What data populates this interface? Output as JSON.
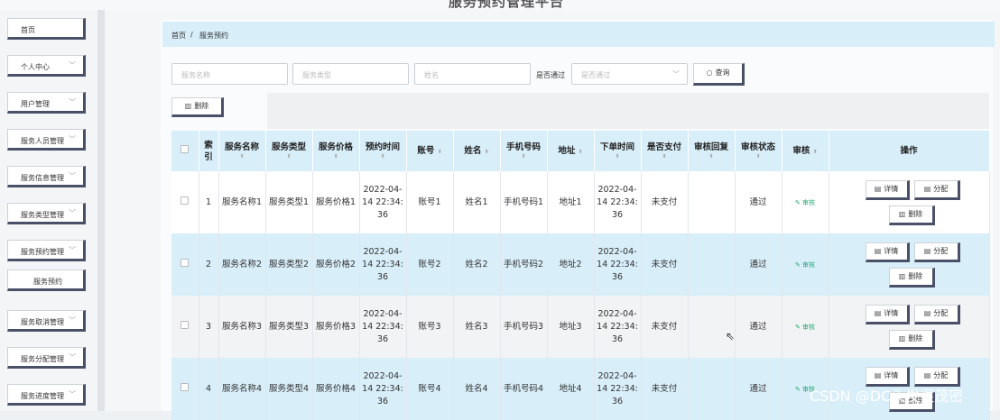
{
  "page": {
    "title": "服务预约管理平台"
  },
  "sidebar": {
    "items": [
      {
        "label": "首页",
        "expandable": false
      },
      {
        "label": "个人中心",
        "expandable": true
      },
      {
        "label": "用户管理",
        "expandable": true
      },
      {
        "label": "服务人员管理",
        "expandable": true
      },
      {
        "label": "服务信息管理",
        "expandable": true
      },
      {
        "label": "服务类型管理",
        "expandable": true
      },
      {
        "label": "服务预约管理",
        "expandable": true
      },
      {
        "label": "服务预约",
        "expandable": false
      },
      {
        "label": "服务取消管理",
        "expandable": true
      },
      {
        "label": "服务分配管理",
        "expandable": true
      },
      {
        "label": "服务进度管理",
        "expandable": true
      }
    ]
  },
  "breadcrumb": {
    "home": "首页",
    "separator": "/",
    "current": "服务预约"
  },
  "filters": {
    "service_name_placeholder": "服务名称",
    "service_type_placeholder": "服务类型",
    "name_placeholder": "姓名",
    "approved_label": "是否通过",
    "approved_placeholder": "是否通过",
    "search_label": "查询",
    "delete_label": "删除"
  },
  "table": {
    "headers": {
      "index": "索引",
      "service_name": "服务名称",
      "service_type": "服务类型",
      "service_price": "服务价格",
      "booking_time": "预约时间",
      "account": "账号",
      "name": "姓名",
      "phone": "手机号码",
      "address": "地址",
      "order_time": "下单时间",
      "paid": "是否支付",
      "audit_reply": "审核回复",
      "audit_status": "审核状态",
      "audit": "审核",
      "actions": "操作"
    },
    "rows": [
      {
        "index": "1",
        "service_name": "服务名称1",
        "service_type": "服务类型1",
        "service_price": "服务价格1",
        "booking_time": "2022-04-14 22:34:36",
        "account": "账号1",
        "name": "姓名1",
        "phone": "手机号码1",
        "address": "地址1",
        "order_time": "2022-04-14 22:34:36",
        "paid": "未支付",
        "audit_reply": "",
        "audit_status": "通过",
        "audit": "审核"
      },
      {
        "index": "2",
        "service_name": "服务名称2",
        "service_type": "服务类型2",
        "service_price": "服务价格2",
        "booking_time": "2022-04-14 22:34:36",
        "account": "账号2",
        "name": "姓名2",
        "phone": "手机号码2",
        "address": "地址2",
        "order_time": "2022-04-14 22:34:36",
        "paid": "未支付",
        "audit_reply": "",
        "audit_status": "通过",
        "audit": "审核"
      },
      {
        "index": "3",
        "service_name": "服务名称3",
        "service_type": "服务类型3",
        "service_price": "服务价格3",
        "booking_time": "2022-04-14 22:34:36",
        "account": "账号3",
        "name": "姓名3",
        "phone": "手机号码3",
        "address": "地址3",
        "order_time": "2022-04-14 22:34:36",
        "paid": "未支付",
        "audit_reply": "",
        "audit_status": "通过",
        "audit": "审核"
      },
      {
        "index": "4",
        "service_name": "服务名称4",
        "service_type": "服务类型4",
        "service_price": "服务价格4",
        "booking_time": "2022-04-14 22:34:36",
        "account": "账号4",
        "name": "姓名4",
        "phone": "手机号码4",
        "address": "地址4",
        "order_time": "2022-04-14 22:34:36",
        "paid": "未支付",
        "audit_reply": "",
        "audit_status": "通过",
        "audit": "审核"
      }
    ],
    "row_actions": {
      "detail": "详情",
      "assign": "分配",
      "delete": "删除"
    }
  },
  "icons": {
    "search": "search-icon",
    "delete": "trash-icon",
    "detail": "document-icon",
    "assign": "document-icon",
    "audit": "edit-icon",
    "chevron": "chevron-down-icon",
    "sort": "sort-icon"
  },
  "colors": {
    "header_bg": "#d8eef9",
    "button_shadow": "#4a5068",
    "audit_green": "#2aa876"
  },
  "watermark": "CSDN @DC头发很茂密"
}
